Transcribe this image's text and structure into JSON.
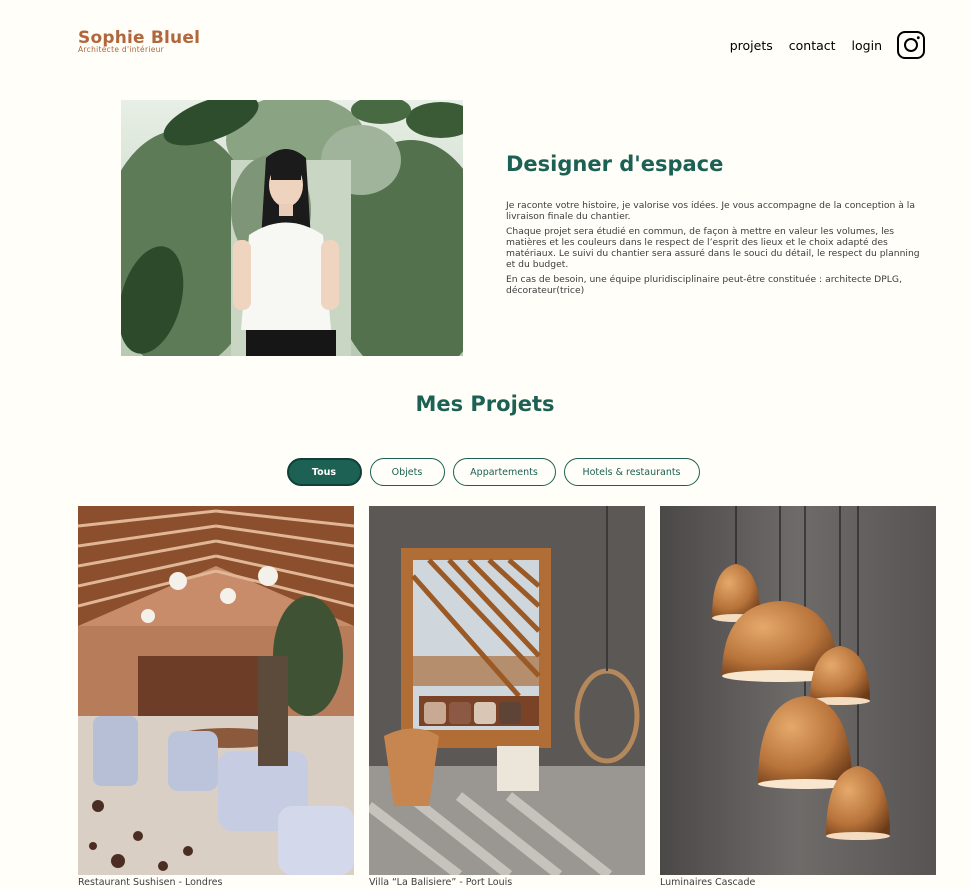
{
  "header": {
    "logo_title": "Sophie Bluel",
    "logo_subtitle": "Architecte d'intérieur",
    "nav": {
      "projets": "projets",
      "contact": "contact",
      "login": "login"
    },
    "social_icon": "instagram-icon"
  },
  "intro": {
    "title": "Designer d'espace",
    "paragraphs": [
      "Je raconte votre histoire, je valorise vos idées. Je vous accompagne de la conception à la livraison finale du chantier.",
      "Chaque projet sera étudié en commun, de façon à mettre en valeur les volumes, les matières et les couleurs dans le respect de l’esprit des lieux et le choix adapté des matériaux. Le suivi du chantier sera assuré dans le souci du détail, le respect du planning et du budget.",
      "En cas de besoin, une équipe pluridisciplinaire peut-être constituée : architecte DPLG, décorateur(trice)"
    ]
  },
  "projects": {
    "title": "Mes Projets",
    "filters": [
      "Tous",
      "Objets",
      "Appartements",
      "Hotels & restaurants"
    ],
    "active_filter": "Tous",
    "items": [
      {
        "caption": "Restaurant Sushisen - Londres"
      },
      {
        "caption": "Villa “La Balisiere” - Port Louis"
      },
      {
        "caption": "Luminaires Cascade"
      }
    ]
  },
  "colors": {
    "brand": "#B1663C",
    "accent": "#1D6154",
    "background": "#FFFEF8"
  }
}
